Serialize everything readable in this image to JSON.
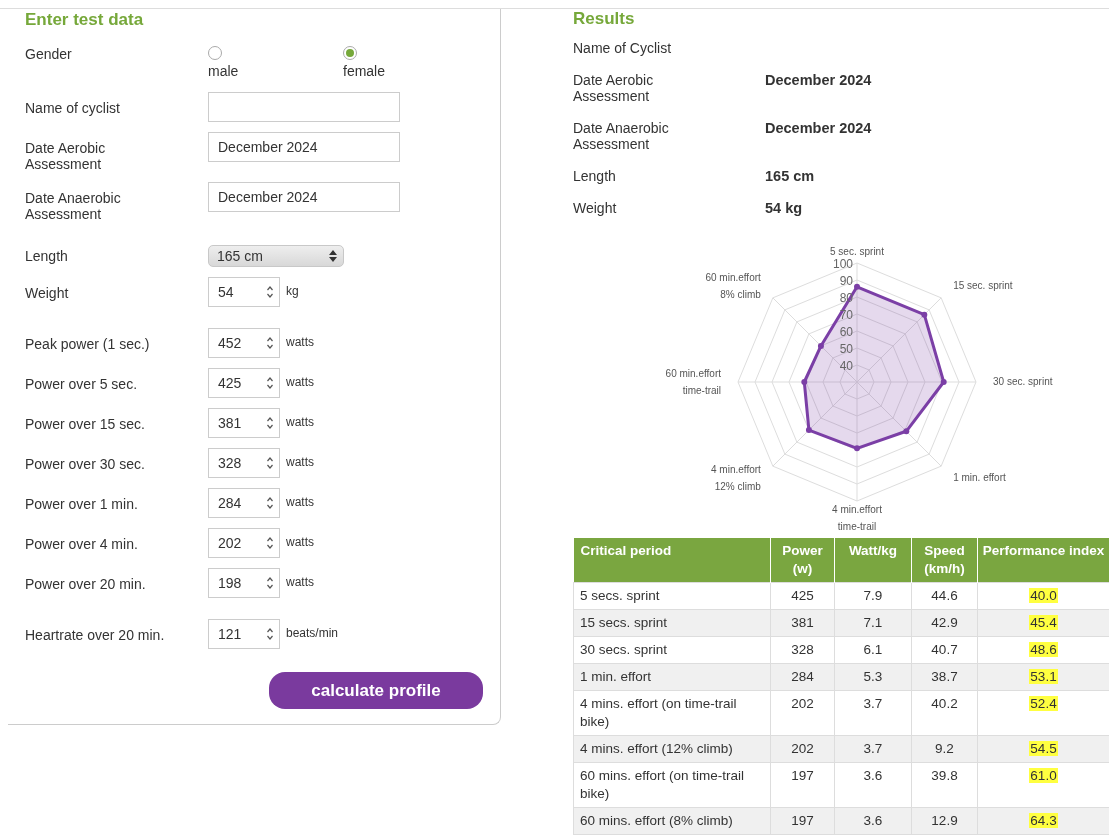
{
  "form": {
    "title": "Enter test data",
    "gender": {
      "label": "Gender",
      "options": [
        {
          "label": "male",
          "selected": false
        },
        {
          "label": "female",
          "selected": true
        }
      ]
    },
    "sections": [
      {
        "fields": [
          {
            "kind": "text",
            "label": "Name of cyclist"
          },
          {
            "kind": "text",
            "label": "Date Aerobic Assessment",
            "value": "December 2024"
          },
          {
            "kind": "text",
            "label": "Date Anaerobic Assessment",
            "value": "December 2024"
          },
          {
            "kind": "select",
            "label": "Length",
            "value": "165 cm"
          },
          {
            "kind": "number",
            "label": "Weight",
            "value": "54",
            "unit": "kg"
          }
        ]
      },
      {
        "fields": [
          {
            "kind": "number",
            "label": "Peak power (1 sec.)",
            "value": "452",
            "unit": "watts"
          },
          {
            "kind": "number",
            "label": "Power over 5 sec.",
            "value": "425",
            "unit": "watts"
          },
          {
            "kind": "number",
            "label": "Power over 15 sec.",
            "value": "381",
            "unit": "watts"
          },
          {
            "kind": "number",
            "label": "Power over 30 sec.",
            "value": "328",
            "unit": "watts"
          },
          {
            "kind": "number",
            "label": "Power over 1 min.",
            "value": "284",
            "unit": "watts"
          },
          {
            "kind": "number",
            "label": "Power over 4 min.",
            "value": "202",
            "unit": "watts"
          },
          {
            "kind": "number",
            "label": "Power over 20 min.",
            "value": "198",
            "unit": "watts"
          }
        ]
      },
      {
        "fields": [
          {
            "kind": "number",
            "label": "Heartrate over 20 min.",
            "value": "121",
            "unit": "beats/min"
          }
        ]
      }
    ],
    "submit_button": "calculate profile"
  },
  "results": {
    "title": "Results",
    "summary": [
      {
        "label": "Name of Cyclist"
      },
      {
        "label": "Date Aerobic Assessment",
        "value": "December 2024"
      },
      {
        "label": "Date Anaerobic Assessment",
        "value": "December 2024"
      },
      {
        "label": "Length",
        "value": "165 cm"
      },
      {
        "label": "Weight",
        "value": "54 kg"
      }
    ],
    "chart_data": {
      "type": "radar",
      "categories": [
        "5 sec. sprint",
        "15 sec. sprint",
        "30 sec. sprint",
        "1 min. effort",
        "4 min.effort\ntime-trail",
        "4 min.effort\n12% climb",
        "60 min.effort\ntime-trail",
        "60 min.effort\n8% climb"
      ],
      "series": [
        {
          "color": "#7b3fa6",
          "values": [
            86,
            86,
            81,
            71,
            69,
            70,
            61,
            60
          ]
        }
      ],
      "ylim": [
        30,
        100
      ],
      "yticks": [
        40,
        50,
        60,
        70,
        80,
        90,
        100
      ]
    },
    "table": {
      "columns": [
        "Critical period",
        "Power (w)",
        "Watt/kg",
        "Speed (km/h)",
        "Performance index"
      ],
      "rows": [
        [
          "5 secs. sprint",
          "425",
          "7.9",
          "44.6",
          "40.0"
        ],
        [
          "15 secs. sprint",
          "381",
          "7.1",
          "42.9",
          "45.4"
        ],
        [
          "30 secs. sprint",
          "328",
          "6.1",
          "40.7",
          "48.6"
        ],
        [
          "1 min. effort",
          "284",
          "5.3",
          "38.7",
          "53.1"
        ],
        [
          "4 mins. effort (on time-trail bike)",
          "202",
          "3.7",
          "40.2",
          "52.4"
        ],
        [
          "4 mins. effort (12% climb)",
          "202",
          "3.7",
          "9.2",
          "54.5"
        ],
        [
          "60 mins. effort (on time-trail bike)",
          "197",
          "3.6",
          "39.8",
          "61.0"
        ],
        [
          "60 mins. effort (8% climb)",
          "197",
          "3.6",
          "12.9",
          "64.3"
        ]
      ]
    }
  }
}
